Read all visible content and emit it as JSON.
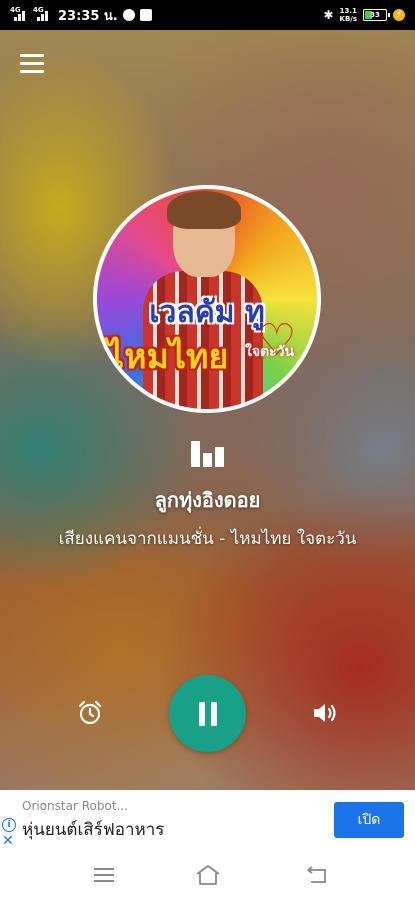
{
  "status_bar": {
    "signal1_label": "4G",
    "signal2_label": "4G",
    "time": "23:35 น.",
    "network_speed_value": "13.1",
    "network_speed_unit": "KB/s",
    "battery_level": "33"
  },
  "player": {
    "menu_icon": "hamburger-menu-icon",
    "album_art": {
      "title_line1": "เวลคัม ทู",
      "title_line2": "ไหมไทย",
      "title_line3": "ใจตะวัน"
    },
    "equalizer_icon": "equalizer-icon",
    "station_name": "ลูกทุ่งอิงดอย",
    "now_playing": "เสียงแคนจากแมนชั่น - ไหมไทย ใจตะวัน",
    "controls": {
      "alarm_icon": "alarm-icon",
      "play_pause_icon": "pause-icon",
      "volume_icon": "volume-icon"
    },
    "accent_color": "#18a188"
  },
  "ad": {
    "brand": "Orionstar Robot...",
    "title": "หุ่นยนต์เสิร์ฟอาหาร",
    "button_label": "เปิด",
    "button_color": "#1a73e8"
  },
  "nav_bar": {
    "menu_icon": "recent-apps-icon",
    "home_icon": "home-icon",
    "back_icon": "back-icon"
  }
}
